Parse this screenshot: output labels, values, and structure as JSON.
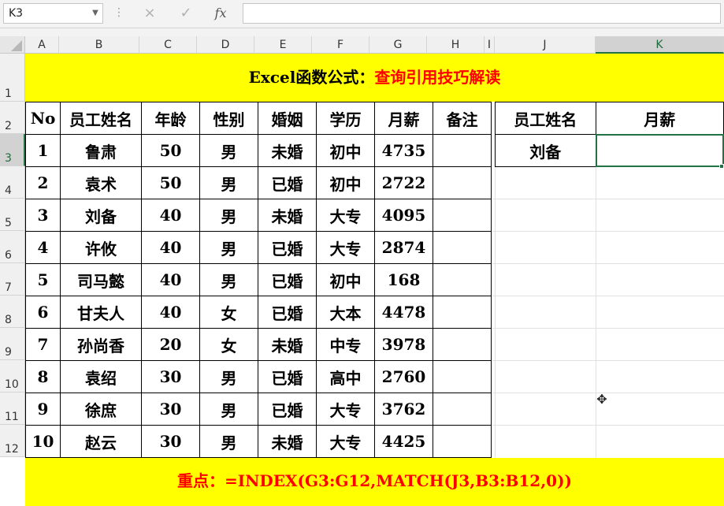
{
  "name_box": "K3",
  "formula_bar": {
    "fx_label": "fx",
    "cancel_icon": "×",
    "enter_icon": "✓",
    "formula": ""
  },
  "columns": [
    "A",
    "B",
    "C",
    "D",
    "E",
    "F",
    "G",
    "H",
    "I",
    "J",
    "K"
  ],
  "rows": [
    "1",
    "2",
    "3",
    "4",
    "5",
    "6",
    "7",
    "8",
    "9",
    "10",
    "11",
    "12"
  ],
  "selected_cell": "K3",
  "title": {
    "black": "Excel函数公式：",
    "red": "查询引用技巧解读"
  },
  "table": {
    "headers": [
      "No",
      "员工姓名",
      "年龄",
      "性别",
      "婚姻",
      "学历",
      "月薪",
      "备注"
    ],
    "rows": [
      [
        "1",
        "鲁肃",
        "50",
        "男",
        "未婚",
        "初中",
        "4735",
        ""
      ],
      [
        "2",
        "袁术",
        "50",
        "男",
        "已婚",
        "初中",
        "2722",
        ""
      ],
      [
        "3",
        "刘备",
        "40",
        "男",
        "未婚",
        "大专",
        "4095",
        ""
      ],
      [
        "4",
        "许攸",
        "40",
        "男",
        "已婚",
        "大专",
        "2874",
        ""
      ],
      [
        "5",
        "司马懿",
        "40",
        "男",
        "已婚",
        "初中",
        "168",
        ""
      ],
      [
        "6",
        "甘夫人",
        "40",
        "女",
        "已婚",
        "大本",
        "4478",
        ""
      ],
      [
        "7",
        "孙尚香",
        "20",
        "女",
        "未婚",
        "中专",
        "3978",
        ""
      ],
      [
        "8",
        "袁绍",
        "30",
        "男",
        "已婚",
        "高中",
        "2760",
        ""
      ],
      [
        "9",
        "徐庶",
        "30",
        "男",
        "已婚",
        "大专",
        "3762",
        ""
      ],
      [
        "10",
        "赵云",
        "30",
        "男",
        "未婚",
        "大专",
        "4425",
        ""
      ]
    ]
  },
  "lookup": {
    "headers": [
      "员工姓名",
      "月薪"
    ],
    "name": "刘备",
    "salary": ""
  },
  "key_point": "重点：=INDEX(G3:G12,MATCH(J3,B3:B12,0))",
  "colors": {
    "highlight": "#ffff00",
    "accent_red": "#ff0000",
    "selection": "#217346"
  }
}
